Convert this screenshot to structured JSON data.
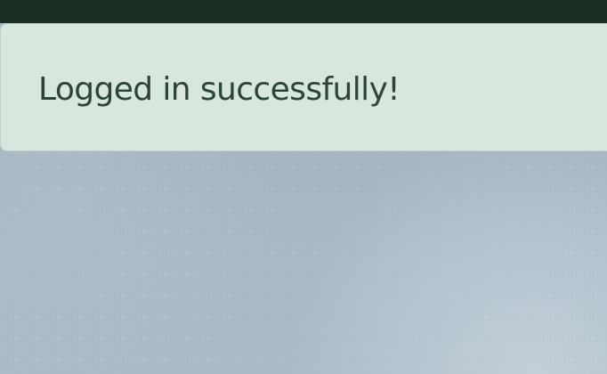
{
  "alert": {
    "message": "Logged in successfully!"
  },
  "colors": {
    "top_bar": "#1b2e23",
    "alert_background": "#d8e6dd",
    "alert_text": "#2c4636",
    "backdrop": "#a9bac8"
  }
}
